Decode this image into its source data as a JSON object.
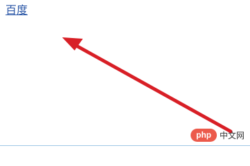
{
  "link": {
    "text": "百度"
  },
  "watermark": {
    "badge": "php",
    "suffix": "中文网"
  },
  "colors": {
    "link": "#2a56a6",
    "arrow": "#d81f26",
    "badge": "#ec5a4b",
    "divider": "#9fc7e5"
  },
  "icons": {
    "annotation": "red-arrow-icon"
  }
}
